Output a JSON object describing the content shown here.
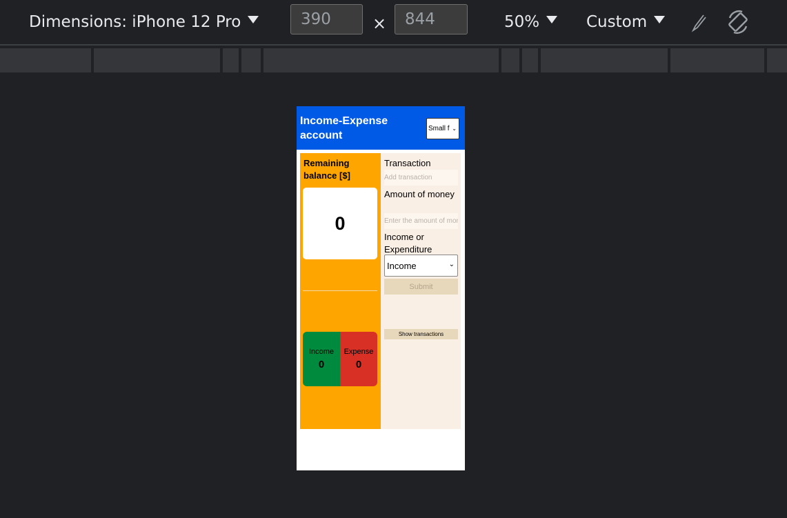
{
  "devtools": {
    "dimensions_label": "Dimensions: iPhone 12 Pro",
    "width_value": "390",
    "height_value": "844",
    "times_symbol": "×",
    "zoom": "50%",
    "throttle": "Custom"
  },
  "app": {
    "title": "Income-Expense account",
    "font_size_select": "Small f",
    "balance_label": "Remaining balance [$]",
    "balance_value": "0",
    "income_label": "Income",
    "income_value": "0",
    "expense_label": "Expense",
    "expense_value": "0",
    "form": {
      "transaction_label": "Transaction",
      "transaction_placeholder": "Add transaction",
      "amount_label": "Amount of money",
      "amount_placeholder": "Enter the amount of money",
      "type_label": "Income or Expenditure",
      "type_selected": "Income",
      "submit_label": "Submit",
      "show_transactions_label": "Show transactions"
    }
  },
  "colors": {
    "header": "#005ae6",
    "balance_panel": "#ffa500",
    "income": "#008a3e",
    "expense": "#d93025",
    "form_panel": "#faefe5"
  }
}
